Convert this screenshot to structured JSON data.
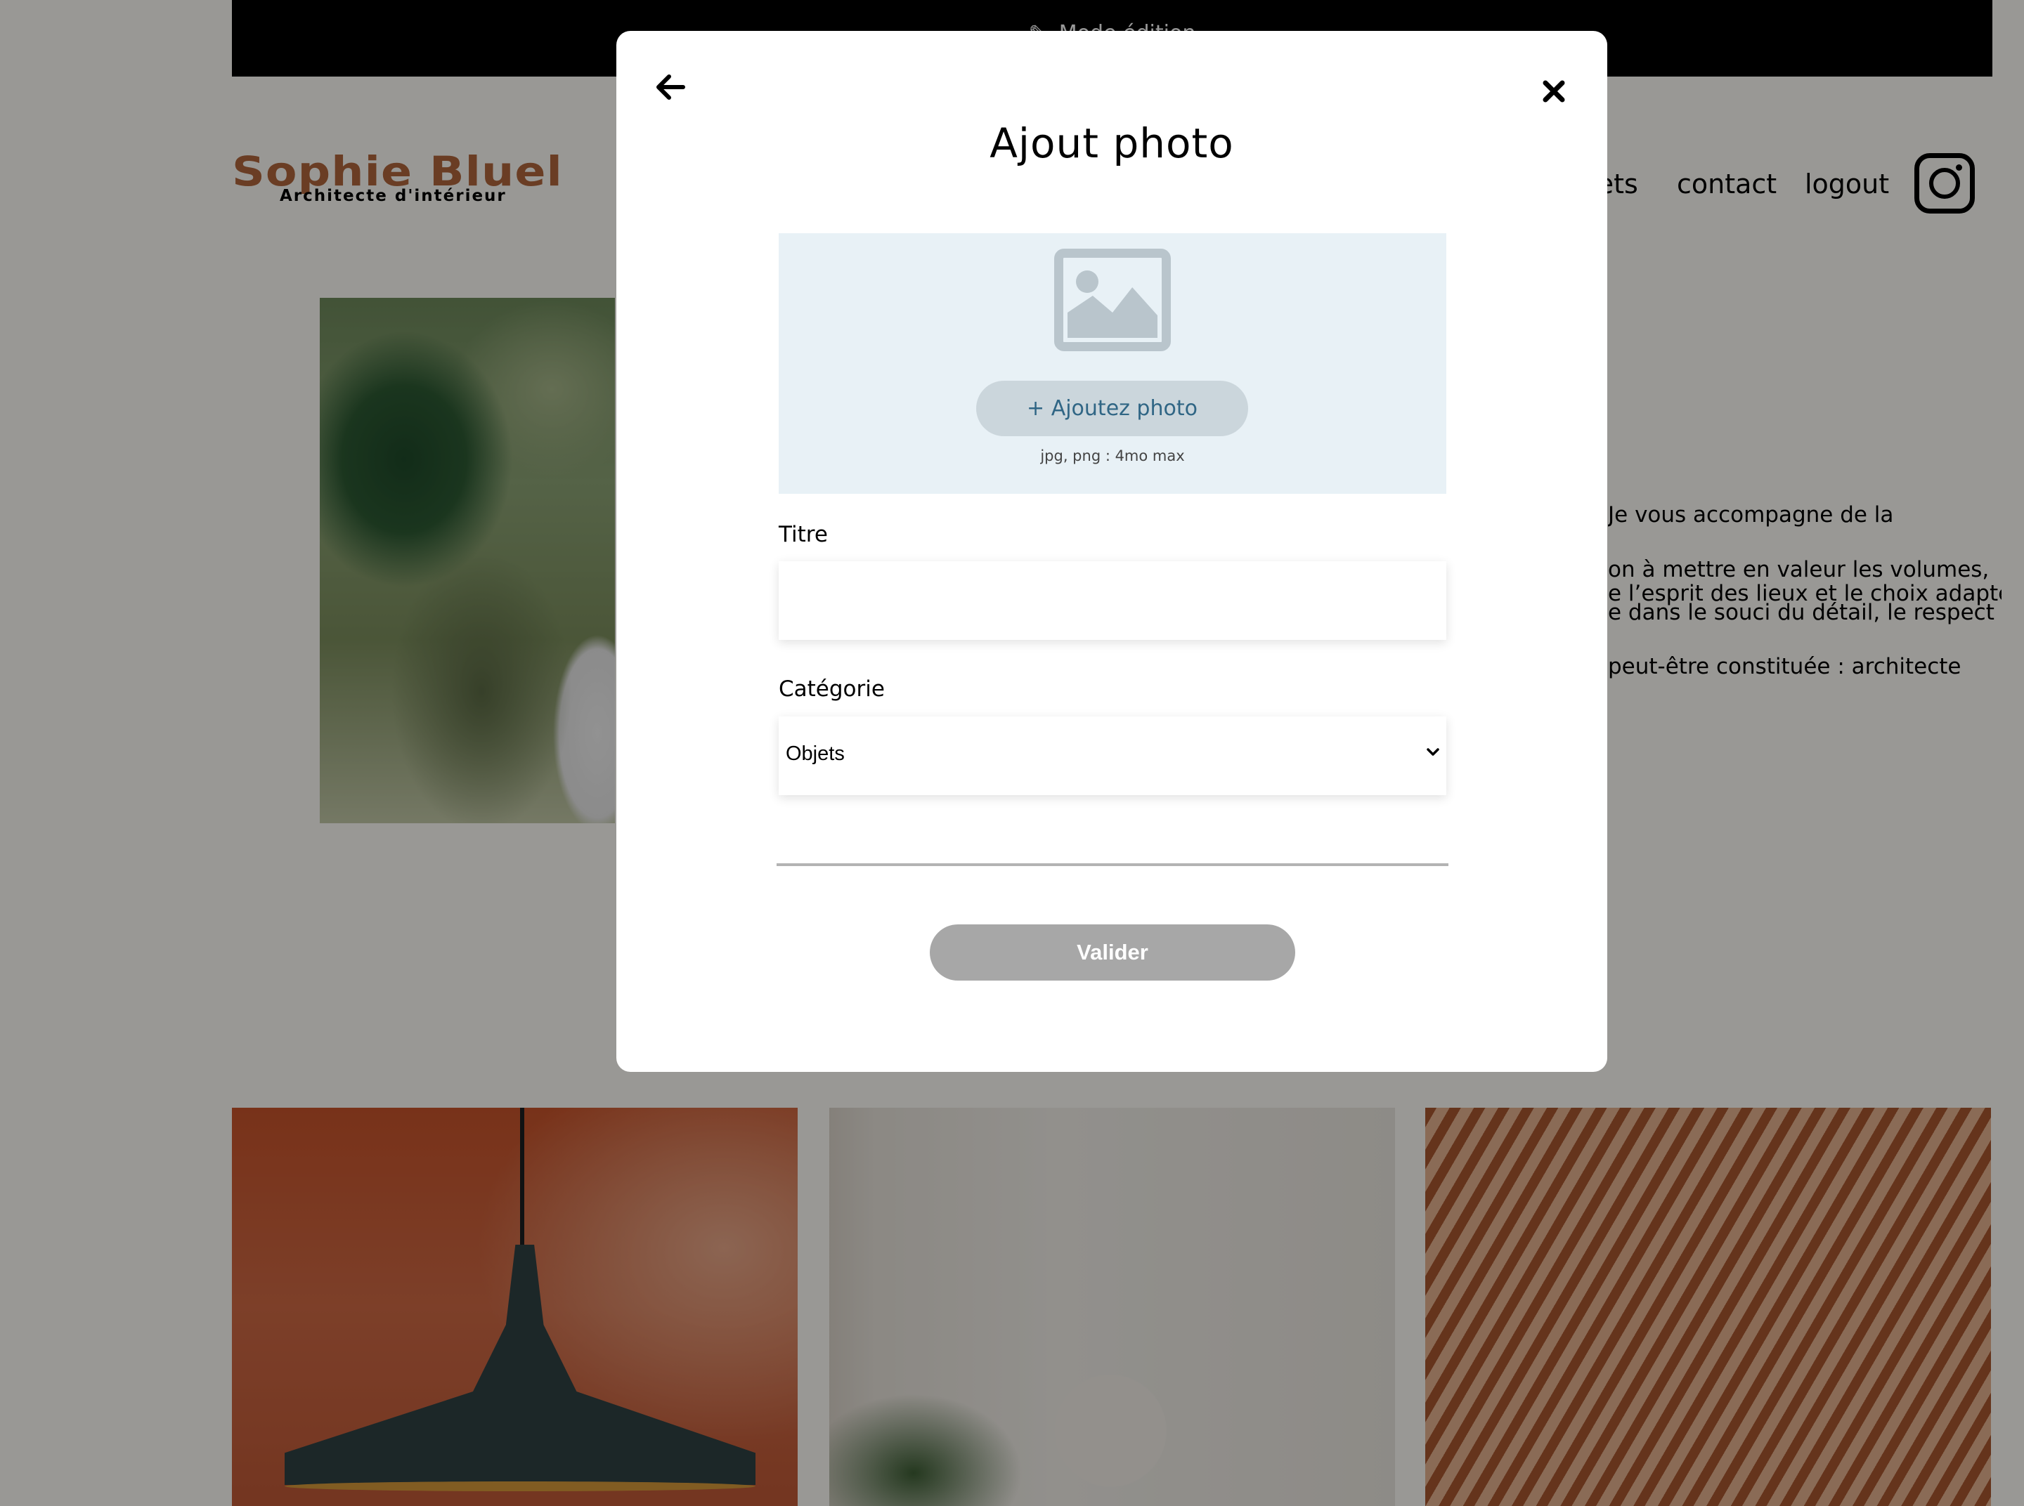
{
  "banner": {
    "text": "Mode édition"
  },
  "brand": {
    "name": "Sophie Bluel",
    "tagline": "Architecte d'intérieur"
  },
  "nav": {
    "items": [
      "projets",
      "contact",
      "logout"
    ]
  },
  "intro": {
    "lines": [
      "Je vous accompagne de la",
      "on à mettre en valeur les volumes,",
      "e l’esprit des lieux et le choix adapté",
      "e dans le souci du détail, le respect",
      "peut-être constituée : architecte"
    ]
  },
  "modal": {
    "title": "Ajout photo",
    "add_photo_label": "+ Ajoutez photo",
    "upload_hint": "jpg, png : 4mo max",
    "title_label": "Titre",
    "title_value": "",
    "category_label": "Catégorie",
    "category_value": "Objets",
    "submit_label": "Valider"
  },
  "icons": {
    "back": "arrow-left-icon",
    "close": "close-icon",
    "upload": "image-icon",
    "instagram": "instagram-icon"
  },
  "colors": {
    "brand": "#b1663c",
    "upload_bg": "#e8f1f6",
    "add_button_bg": "#cbd6dc",
    "add_button_text": "#306685",
    "submit_disabled": "#a7a7a7"
  }
}
